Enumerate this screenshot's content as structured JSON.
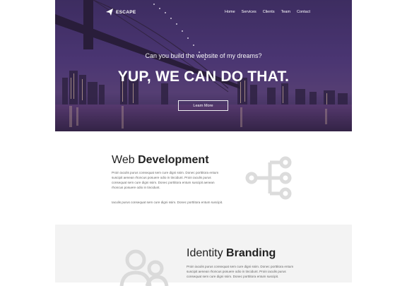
{
  "brand": {
    "name": "ESCAPE"
  },
  "nav": {
    "items": [
      "Home",
      "Services",
      "Clients",
      "Team",
      "Contact"
    ]
  },
  "hero": {
    "subtitle": "Can you build the website of my dreams?",
    "title": "YUP, WE CAN DO THAT.",
    "button": "Learn More"
  },
  "web_dev": {
    "title_light": "Web ",
    "title_bold": "Development",
    "body": "Proin iaculis purus consequat sem cure digni ssim. Donec porttitora entum suscipit aenean rhoncus posuere odio in tincidunt. Proin iaculis purus consequat sem cure digni ssim. Donec porttitora entum suscipit aenean rhoncus posuere odio in tincidunt.",
    "body2": "Iaculis purus consequat sem cure digni ssim. Donec porttitora entum suscipit."
  },
  "branding": {
    "title_light": "Identity ",
    "title_bold": "Branding",
    "body": "Proin iaculis purus consequat sem cure digni ssim. Donec porttitora entum suscipit aenean rhoncus posuere odio in tincidunt. Proin iaculis purus consequat sem cure digni ssim. Donec porttitora entum suscipit."
  }
}
